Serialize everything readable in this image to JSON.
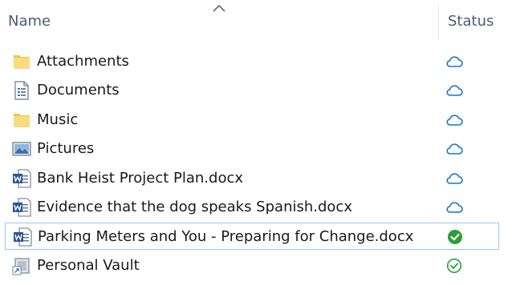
{
  "header": {
    "name_label": "Name",
    "status_label": "Status",
    "sort_icon": "sort-ascending-caret-icon"
  },
  "rows": [
    {
      "name": "Attachments",
      "type": "folder",
      "status": "cloud-icon",
      "selected": false
    },
    {
      "name": "Documents",
      "type": "documents-library",
      "status": "cloud-icon",
      "selected": false
    },
    {
      "name": "Music",
      "type": "folder",
      "status": "cloud-icon",
      "selected": false
    },
    {
      "name": "Pictures",
      "type": "pictures-library",
      "status": "cloud-icon",
      "selected": false
    },
    {
      "name": "Bank Heist Project Plan.docx",
      "type": "word-document",
      "status": "cloud-icon",
      "selected": false
    },
    {
      "name": "Evidence that the dog speaks Spanish.docx",
      "type": "word-document",
      "status": "cloud-icon",
      "selected": false
    },
    {
      "name": "Parking Meters and You - Preparing for Change.docx",
      "type": "word-document",
      "status": "filled-check-icon",
      "selected": true
    },
    {
      "name": "Personal Vault",
      "type": "vault-shortcut",
      "status": "outline-check-icon",
      "selected": false
    }
  ],
  "colors": {
    "cloud_blue": "#1a73c9",
    "check_green": "#2e9e3a",
    "folder_yellow": "#f7d774",
    "word_blue": "#2b579a",
    "selection_border": "#99c9ef",
    "header_text": "#4a5c75"
  }
}
